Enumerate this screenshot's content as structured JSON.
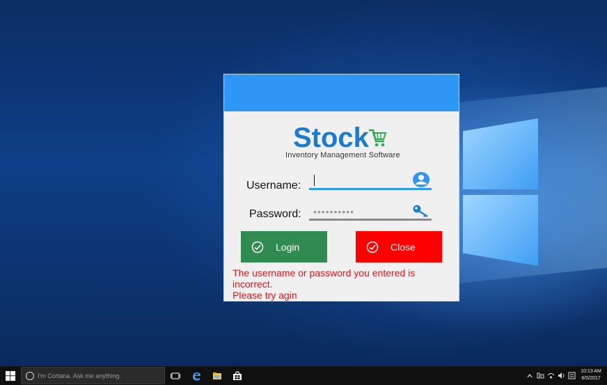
{
  "desktop": {
    "accent_color": "#2e96f5"
  },
  "login_dialog": {
    "logo_title": "Stock",
    "logo_icon": "cart-icon",
    "logo_subtitle": "Inventory Management Software",
    "username_label": "Username:",
    "username_value": "",
    "username_icon": "user-icon",
    "password_label": "Password:",
    "password_value": "••••••••••",
    "password_icon": "key-icon",
    "login_button": "Login",
    "close_button": "Close",
    "error_line1": "The username or password you entered is incorrect.",
    "error_line2": "Please try agin",
    "colors": {
      "header": "#2e96f5",
      "login": "#2f8b50",
      "close": "#ff0000",
      "error": "#d31b1b"
    }
  },
  "taskbar": {
    "search_placeholder": "I'm Cortana. Ask me anything.",
    "clock_time": "10:13 AM",
    "clock_date": "6/5/2017",
    "tray_icons": [
      "chevron-up-icon",
      "network-icon",
      "volume-icon",
      "notification-icon"
    ]
  }
}
